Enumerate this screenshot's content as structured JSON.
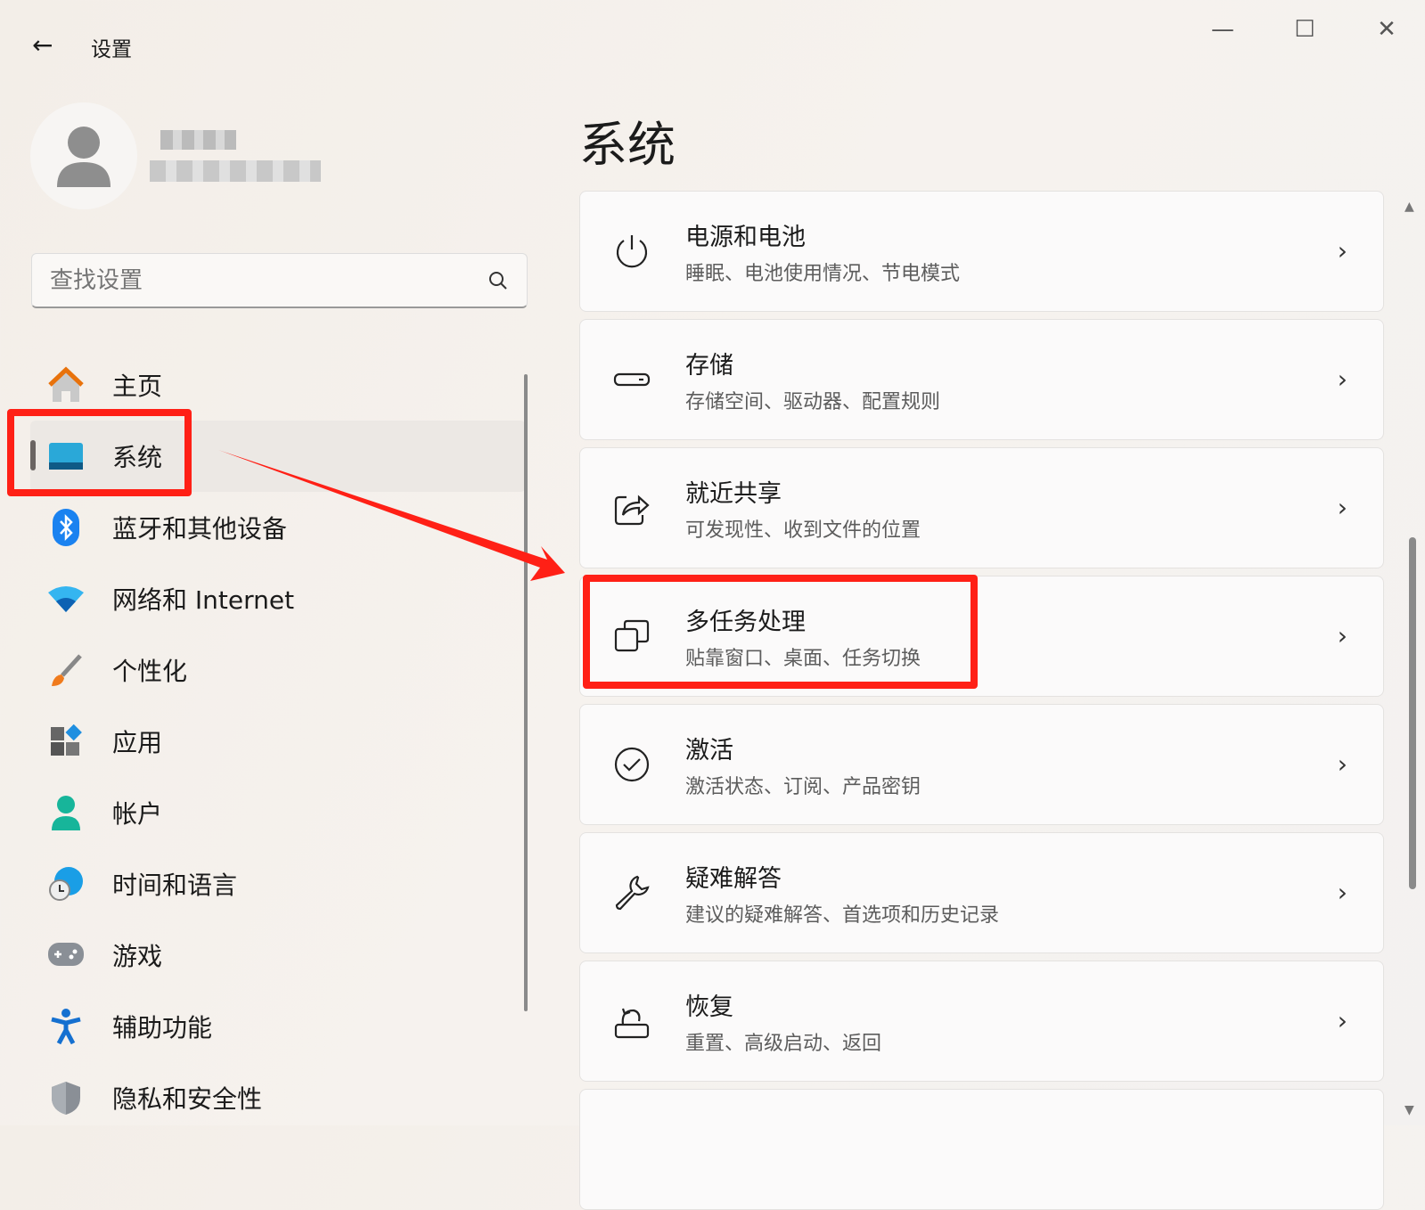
{
  "window": {
    "title": "设置",
    "back": "←",
    "minimize": "—",
    "maximize": "☐",
    "close": "✕"
  },
  "search": {
    "placeholder": "查找设置"
  },
  "nav": [
    {
      "label": "主页",
      "icon": "home-icon"
    },
    {
      "label": "系统",
      "icon": "system-icon",
      "selected": true
    },
    {
      "label": "蓝牙和其他设备",
      "icon": "bluetooth-icon"
    },
    {
      "label": "网络和 Internet",
      "icon": "wifi-icon"
    },
    {
      "label": "个性化",
      "icon": "brush-icon"
    },
    {
      "label": "应用",
      "icon": "apps-icon"
    },
    {
      "label": "帐户",
      "icon": "account-icon"
    },
    {
      "label": "时间和语言",
      "icon": "globe-clock-icon"
    },
    {
      "label": "游戏",
      "icon": "gamepad-icon"
    },
    {
      "label": "辅助功能",
      "icon": "accessibility-icon"
    },
    {
      "label": "隐私和安全性",
      "icon": "shield-icon"
    }
  ],
  "main": {
    "title": "系统",
    "cards": [
      {
        "title": "电源和电池",
        "sub": "睡眠、电池使用情况、节电模式",
        "icon": "power-icon"
      },
      {
        "title": "存储",
        "sub": "存储空间、驱动器、配置规则",
        "icon": "storage-icon"
      },
      {
        "title": "就近共享",
        "sub": "可发现性、收到文件的位置",
        "icon": "share-icon"
      },
      {
        "title": "多任务处理",
        "sub": "贴靠窗口、桌面、任务切换",
        "icon": "multitask-icon"
      },
      {
        "title": "激活",
        "sub": "激活状态、订阅、产品密钥",
        "icon": "check-circle-icon"
      },
      {
        "title": "疑难解答",
        "sub": "建议的疑难解答、首选项和历史记录",
        "icon": "wrench-icon"
      },
      {
        "title": "恢复",
        "sub": "重置、高级启动、返回",
        "icon": "recovery-icon"
      }
    ]
  },
  "annotation_color": "#ff2016"
}
